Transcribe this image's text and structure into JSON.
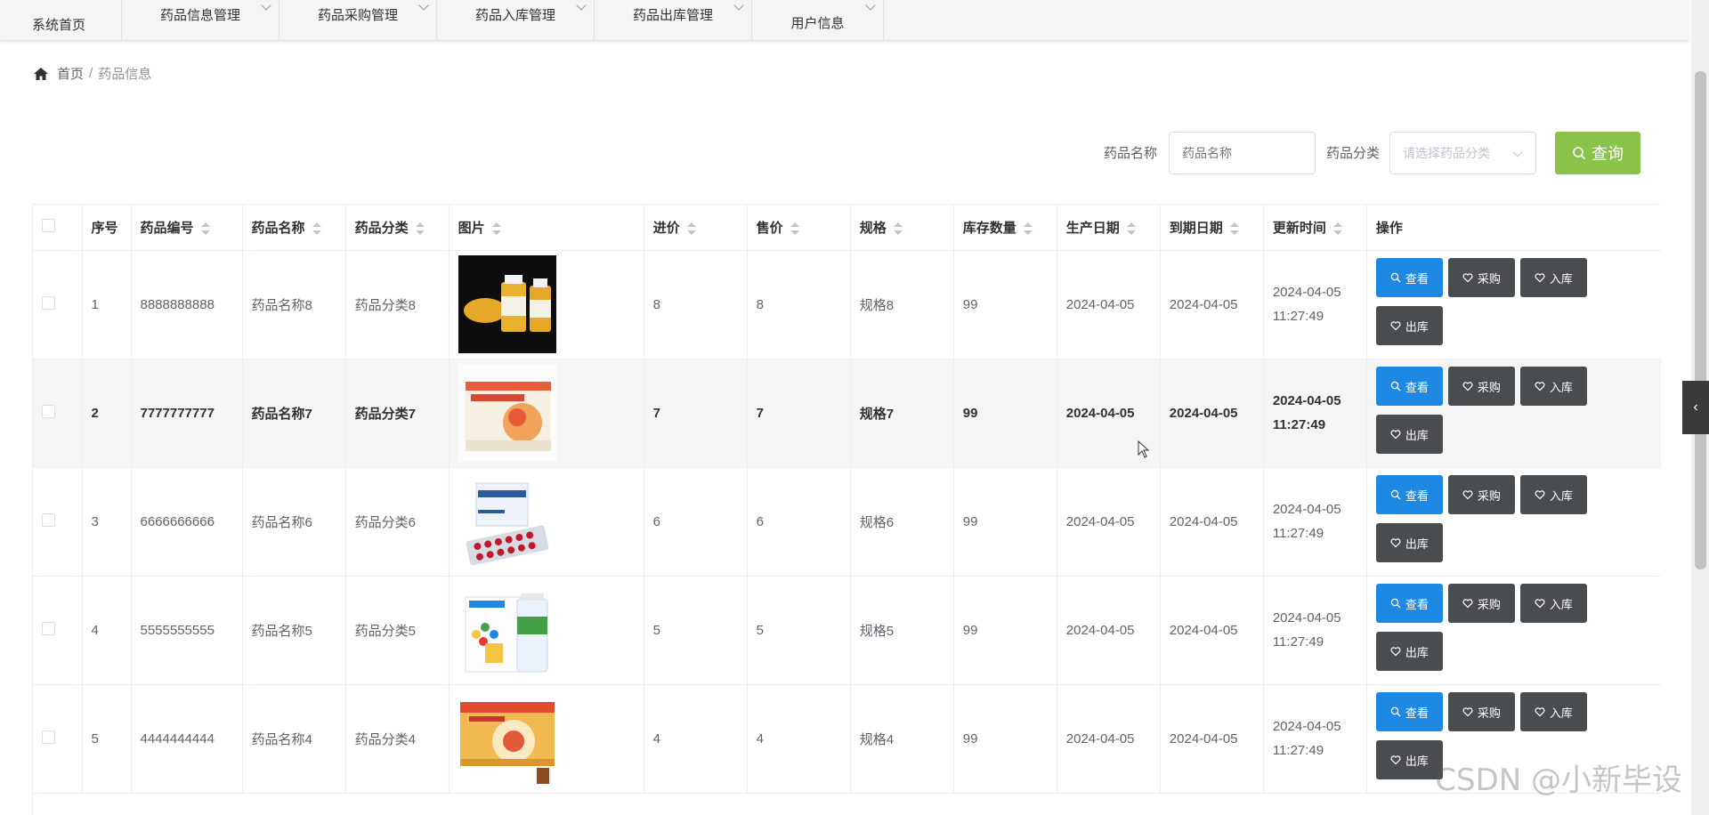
{
  "nav": {
    "items": [
      {
        "label": "系统首页",
        "dropdown": false
      },
      {
        "label": "药品信息管理",
        "dropdown": true
      },
      {
        "label": "药品采购管理",
        "dropdown": true
      },
      {
        "label": "药品入库管理",
        "dropdown": true
      },
      {
        "label": "药品出库管理",
        "dropdown": true
      },
      {
        "label": "用户信息",
        "dropdown": true
      }
    ]
  },
  "breadcrumb": {
    "home": "首页",
    "separator": "/",
    "current": "药品信息"
  },
  "search": {
    "name_label": "药品名称",
    "name_placeholder": "药品名称",
    "category_label": "药品分类",
    "category_placeholder": "请选择药品分类",
    "query_label": "查询"
  },
  "table": {
    "headers": {
      "index": "序号",
      "code": "药品编号",
      "name": "药品名称",
      "category": "药品分类",
      "image": "图片",
      "purchase_price": "进价",
      "sale_price": "售价",
      "spec": "规格",
      "stock": "库存数量",
      "production_date": "生产日期",
      "expiry_date": "到期日期",
      "updated": "更新时间",
      "actions": "操作"
    },
    "action_labels": {
      "view": "查看",
      "purchase": "采购",
      "in": "入库",
      "out": "出库"
    },
    "rows": [
      {
        "index": "1",
        "code": "8888888888",
        "name": "药品名称8",
        "category": "药品分类8",
        "purchase_price": "8",
        "sale_price": "8",
        "spec": "规格8",
        "stock": "99",
        "production_date": "2024-04-05",
        "expiry_date": "2024-04-05",
        "updated_date": "2024-04-05",
        "updated_time": "11:27:49"
      },
      {
        "index": "2",
        "code": "7777777777",
        "name": "药品名称7",
        "category": "药品分类7",
        "purchase_price": "7",
        "sale_price": "7",
        "spec": "规格7",
        "stock": "99",
        "production_date": "2024-04-05",
        "expiry_date": "2024-04-05",
        "updated_date": "2024-04-05",
        "updated_time": "11:27:49"
      },
      {
        "index": "3",
        "code": "6666666666",
        "name": "药品名称6",
        "category": "药品分类6",
        "purchase_price": "6",
        "sale_price": "6",
        "spec": "规格6",
        "stock": "99",
        "production_date": "2024-04-05",
        "expiry_date": "2024-04-05",
        "updated_date": "2024-04-05",
        "updated_time": "11:27:49"
      },
      {
        "index": "4",
        "code": "5555555555",
        "name": "药品名称5",
        "category": "药品分类5",
        "purchase_price": "5",
        "sale_price": "5",
        "spec": "规格5",
        "stock": "99",
        "production_date": "2024-04-05",
        "expiry_date": "2024-04-05",
        "updated_date": "2024-04-05",
        "updated_time": "11:27:49"
      },
      {
        "index": "5",
        "code": "4444444444",
        "name": "药品名称4",
        "category": "药品分类4",
        "purchase_price": "4",
        "sale_price": "4",
        "spec": "规格4",
        "stock": "99",
        "production_date": "2024-04-05",
        "expiry_date": "2024-04-05",
        "updated_date": "2024-04-05",
        "updated_time": "11:27:49"
      }
    ]
  },
  "watermark": "CSDN @小新毕设",
  "colors": {
    "primary": "#1e88e5",
    "dark_button": "#4a4d50",
    "query_button": "#8bc34a",
    "row_highlight": "#f5f5f5"
  }
}
